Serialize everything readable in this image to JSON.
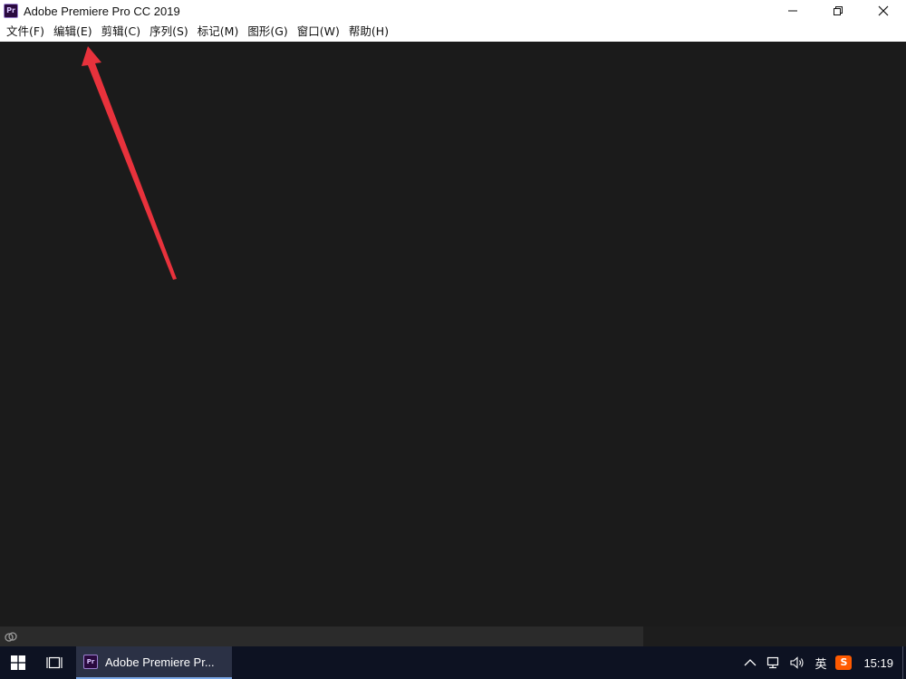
{
  "window": {
    "title": "Adobe Premiere Pro CC 2019",
    "app_icon_text": "Pr",
    "controls": [
      "minimize-icon",
      "restore-icon",
      "close-icon"
    ]
  },
  "menubar": {
    "items": [
      {
        "label": "文件(F)"
      },
      {
        "label": "编辑(E)"
      },
      {
        "label": "剪辑(C)"
      },
      {
        "label": "序列(S)"
      },
      {
        "label": "标记(M)"
      },
      {
        "label": "图形(G)"
      },
      {
        "label": "窗口(W)"
      },
      {
        "label": "帮助(H)"
      }
    ]
  },
  "annotation": {
    "color": "#e8323c"
  },
  "statusbar": {
    "icon": "creative-cloud-sync-icon"
  },
  "taskbar": {
    "start_icon": "windows-start-icon",
    "task_view_icon": "task-view-icon",
    "active_app": {
      "icon_text": "Pr",
      "label": "Adobe Premiere Pr..."
    },
    "tray": {
      "ime_label": "英",
      "ime_badge": "S",
      "time": "15:19"
    }
  },
  "colors": {
    "workspace": "#1b1b1b",
    "taskbar": "#0d1222",
    "accent": "#7aa7e6"
  }
}
